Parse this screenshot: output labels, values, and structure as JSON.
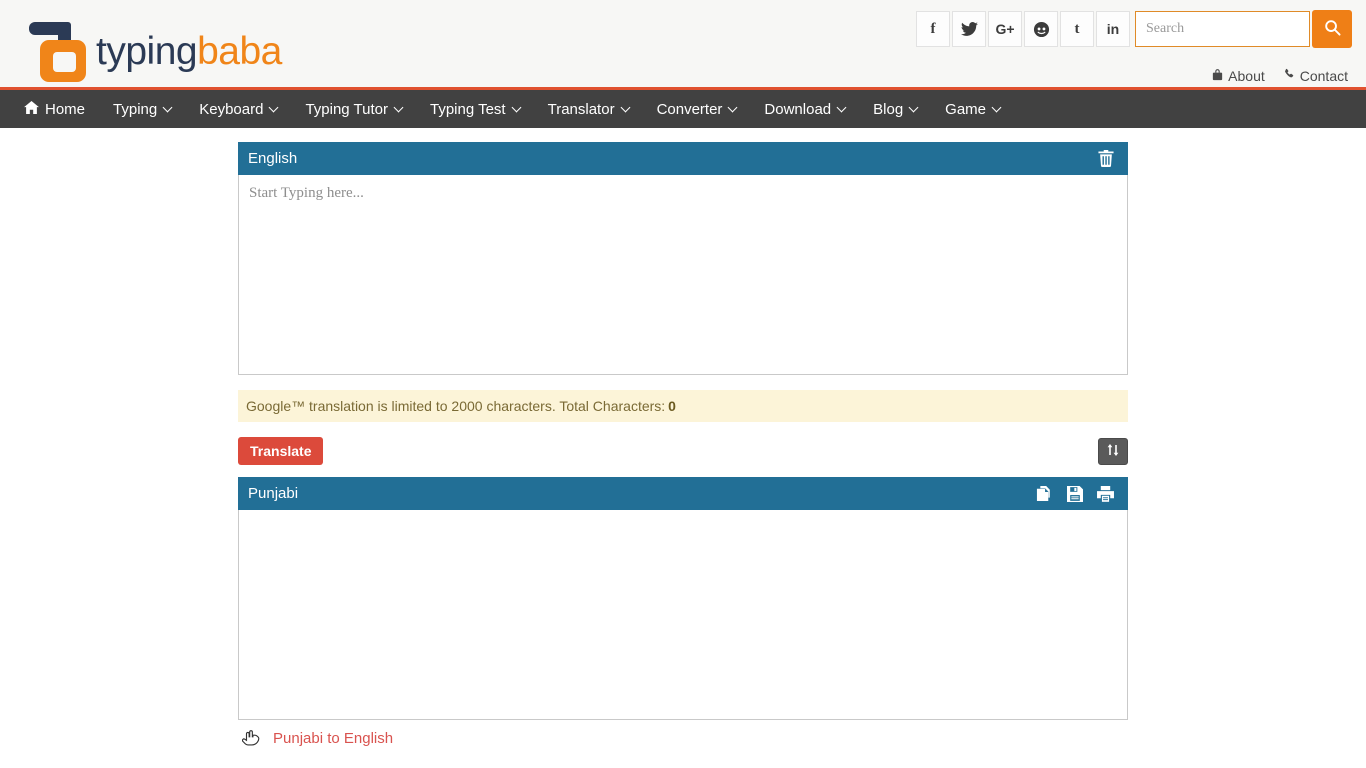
{
  "header": {
    "logo": {
      "part1": "typing",
      "part2": "baba"
    },
    "social": [
      {
        "name": "facebook-icon",
        "label": "f"
      },
      {
        "name": "twitter-icon",
        "label": ""
      },
      {
        "name": "google-plus-icon",
        "label": "G+"
      },
      {
        "name": "reddit-icon",
        "label": ""
      },
      {
        "name": "tumblr-icon",
        "label": "t"
      },
      {
        "name": "linkedin-icon",
        "label": "in"
      }
    ],
    "search": {
      "placeholder": "Search",
      "value": ""
    },
    "links": [
      {
        "label": "About",
        "icon": "info-icon"
      },
      {
        "label": "Contact",
        "icon": "phone-icon"
      }
    ]
  },
  "nav": {
    "items": [
      {
        "label": "Home",
        "caret": false,
        "home": true
      },
      {
        "label": "Typing",
        "caret": true
      },
      {
        "label": "Keyboard",
        "caret": true
      },
      {
        "label": "Typing Tutor",
        "caret": true
      },
      {
        "label": "Typing Test",
        "caret": true
      },
      {
        "label": "Translator",
        "caret": true
      },
      {
        "label": "Converter",
        "caret": true
      },
      {
        "label": "Download",
        "caret": true
      },
      {
        "label": "Blog",
        "caret": true
      },
      {
        "label": "Game",
        "caret": true
      }
    ]
  },
  "source_panel": {
    "title": "English",
    "clear_icon": "trash-icon",
    "textarea_placeholder": "Start Typing here...",
    "textarea_value": ""
  },
  "notice": {
    "text": "Google™ translation is limited to 2000 characters. Total Characters:",
    "count": "0"
  },
  "actions": {
    "translate_label": "Translate",
    "swap_icon": "exchange-vertical-icon"
  },
  "target_panel": {
    "title": "Punjabi",
    "icons": [
      "copy-icon",
      "save-icon",
      "print-icon"
    ],
    "output_value": ""
  },
  "footer_link": {
    "icon": "pointing-hand-icon",
    "label": "Punjabi to English"
  },
  "colors": {
    "accent_orange": "#ef7f16",
    "nav_dark": "#414141",
    "panel_blue": "#226f96",
    "translate_red": "#dc4a3b",
    "notice_bg": "#fcf4d8",
    "link_red": "#d9534f",
    "logo_navy": "#2b3a55"
  }
}
